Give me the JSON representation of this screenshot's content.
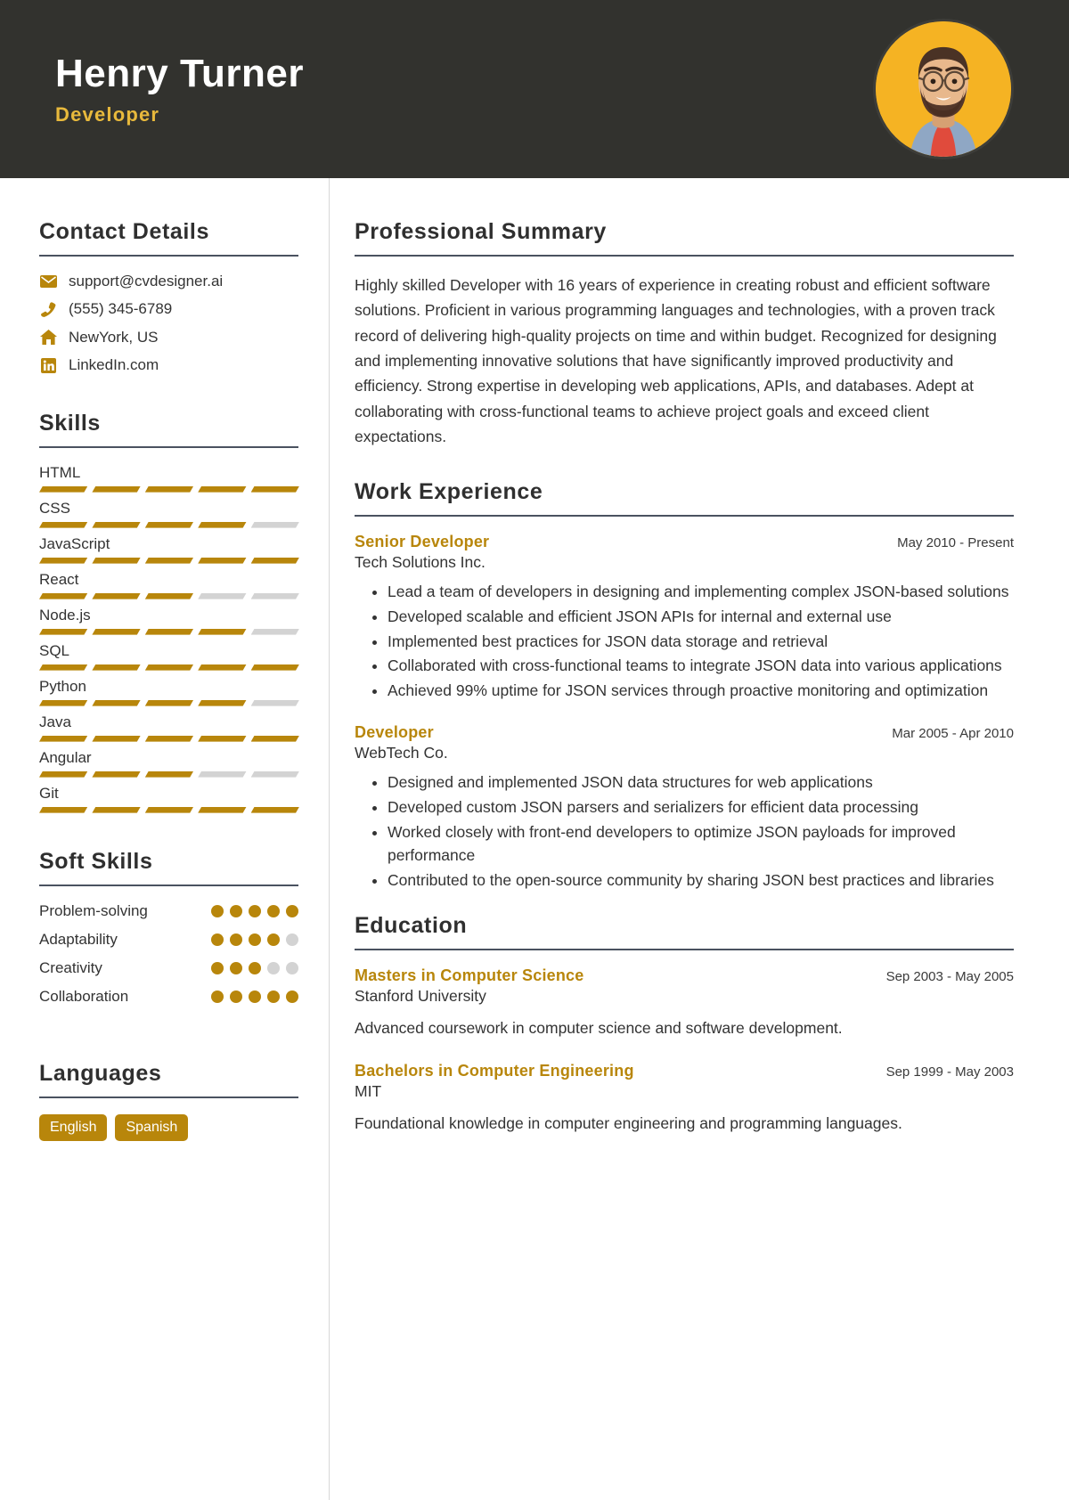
{
  "header": {
    "name": "Henry Turner",
    "title": "Developer",
    "avatar_alt": "profile-photo",
    "background_color": "#32322e",
    "accent_color": "#e8b93c"
  },
  "accent_color": "#b8860b",
  "sidebar": {
    "contact": {
      "heading": "Contact Details",
      "items": [
        {
          "icon": "envelope-icon",
          "value": "support@cvdesigner.ai"
        },
        {
          "icon": "phone-icon",
          "value": "(555) 345-6789"
        },
        {
          "icon": "home-icon",
          "value": "NewYork, US"
        },
        {
          "icon": "linkedin-icon",
          "value": "LinkedIn.com"
        }
      ]
    },
    "skills": {
      "heading": "Skills",
      "max_level": 5,
      "items": [
        {
          "name": "HTML",
          "level": 5
        },
        {
          "name": "CSS",
          "level": 4
        },
        {
          "name": "JavaScript",
          "level": 5
        },
        {
          "name": "React",
          "level": 3
        },
        {
          "name": "Node.js",
          "level": 4
        },
        {
          "name": "SQL",
          "level": 5
        },
        {
          "name": "Python",
          "level": 4
        },
        {
          "name": "Java",
          "level": 5
        },
        {
          "name": "Angular",
          "level": 3
        },
        {
          "name": "Git",
          "level": 5
        }
      ]
    },
    "soft_skills": {
      "heading": "Soft Skills",
      "max_level": 5,
      "items": [
        {
          "name": "Problem-solving",
          "level": 5
        },
        {
          "name": "Adaptability",
          "level": 4
        },
        {
          "name": "Creativity",
          "level": 3
        },
        {
          "name": "Collaboration",
          "level": 5
        }
      ]
    },
    "languages": {
      "heading": "Languages",
      "items": [
        "English",
        "Spanish"
      ]
    }
  },
  "main": {
    "summary": {
      "heading": "Professional Summary",
      "text": "Highly skilled Developer with 16 years of experience in creating robust and efficient software solutions. Proficient in various programming languages and technologies, with a proven track record of delivering high-quality projects on time and within budget. Recognized for designing and implementing innovative solutions that have significantly improved productivity and efficiency. Strong expertise in developing web applications, APIs, and databases. Adept at collaborating with cross-functional teams to achieve project goals and exceed client expectations."
    },
    "work": {
      "heading": "Work Experience",
      "entries": [
        {
          "title": "Senior Developer",
          "date": "May 2010 - Present",
          "org": "Tech Solutions Inc.",
          "bullets": [
            "Lead a team of developers in designing and implementing complex JSON-based solutions",
            "Developed scalable and efficient JSON APIs for internal and external use",
            "Implemented best practices for JSON data storage and retrieval",
            "Collaborated with cross-functional teams to integrate JSON data into various applications",
            "Achieved 99% uptime for JSON services through proactive monitoring and optimization"
          ]
        },
        {
          "title": "Developer",
          "date": "Mar 2005 - Apr 2010",
          "org": "WebTech Co.",
          "bullets": [
            "Designed and implemented JSON data structures for web applications",
            "Developed custom JSON parsers and serializers for efficient data processing",
            "Worked closely with front-end developers to optimize JSON payloads for improved performance",
            "Contributed to the open-source community by sharing JSON best practices and libraries"
          ]
        }
      ]
    },
    "education": {
      "heading": "Education",
      "entries": [
        {
          "title": "Masters in Computer Science",
          "date": "Sep 2003 - May 2005",
          "org": "Stanford University",
          "description": "Advanced coursework in computer science and software development."
        },
        {
          "title": "Bachelors in Computer Engineering",
          "date": "Sep 1999 - May 2003",
          "org": "MIT",
          "description": "Foundational knowledge in computer engineering and programming languages."
        }
      ]
    }
  }
}
